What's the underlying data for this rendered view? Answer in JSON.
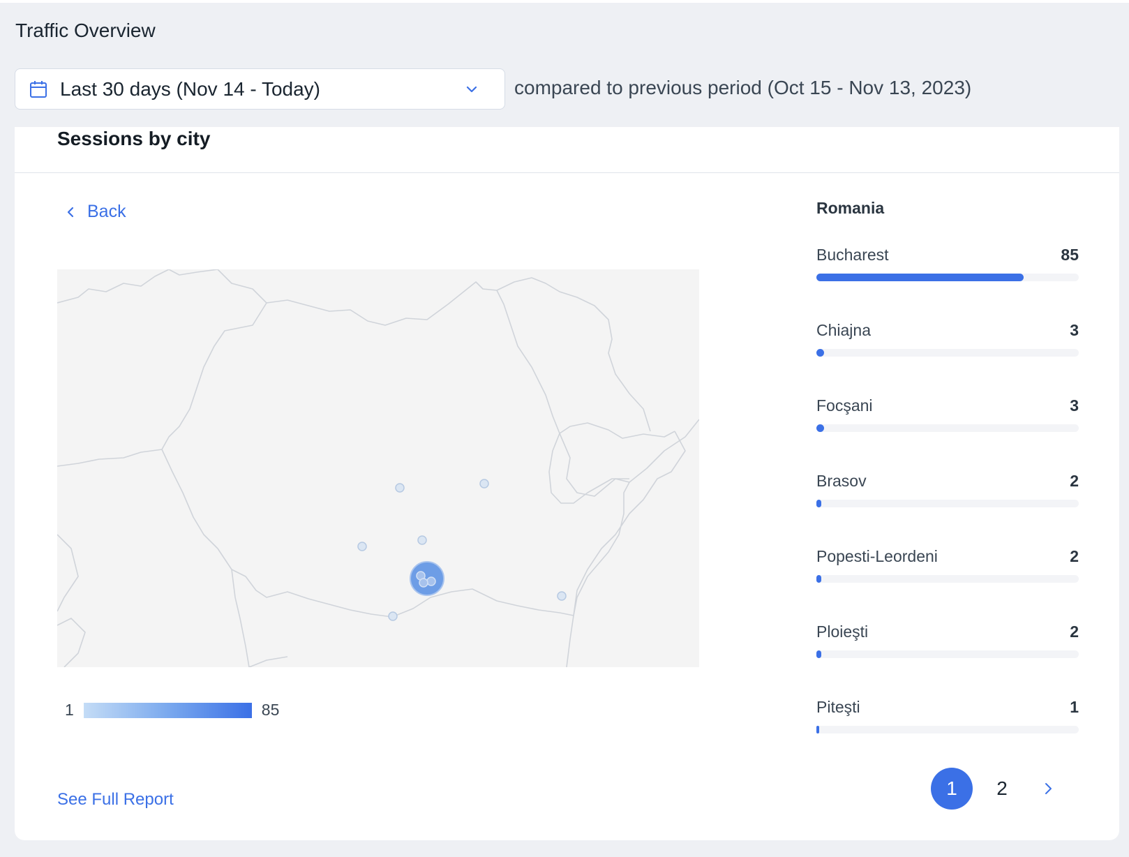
{
  "header": {
    "title": "Traffic Overview",
    "date_range": "Last 30 days (Nov 14 - Today)",
    "comparison": "compared to previous period (Oct 15 - Nov 13, 2023)"
  },
  "card": {
    "title": "Sessions by city",
    "back_label": "Back",
    "region": "Romania",
    "see_full_report": "See Full Report",
    "legend": {
      "min": "1",
      "max": "85"
    },
    "cities": [
      {
        "name": "Bucharest",
        "value": "85",
        "fraction": 0.79
      },
      {
        "name": "Chiajna",
        "value": "3",
        "fraction": 0.028
      },
      {
        "name": "Focşani",
        "value": "3",
        "fraction": 0.028
      },
      {
        "name": "Brasov",
        "value": "2",
        "fraction": 0.019
      },
      {
        "name": "Popesti-Leordeni",
        "value": "2",
        "fraction": 0.019
      },
      {
        "name": "Ploieşti",
        "value": "2",
        "fraction": 0.019
      },
      {
        "name": "Piteşti",
        "value": "1",
        "fraction": 0.009
      }
    ],
    "pagination": {
      "pages": [
        "1",
        "2"
      ],
      "current": "1"
    }
  },
  "colors": {
    "accent": "#3b70e6",
    "map_land": "#f4f4f4",
    "map_border": "#d0d4da",
    "bubble_small": "#c8d9ee",
    "bubble_large": "#6d9de6"
  },
  "icons": {
    "date_picker": "calendar-icon",
    "dropdown": "chevron-down-icon",
    "back": "chevron-left-icon",
    "next_page": "chevron-right-icon"
  }
}
